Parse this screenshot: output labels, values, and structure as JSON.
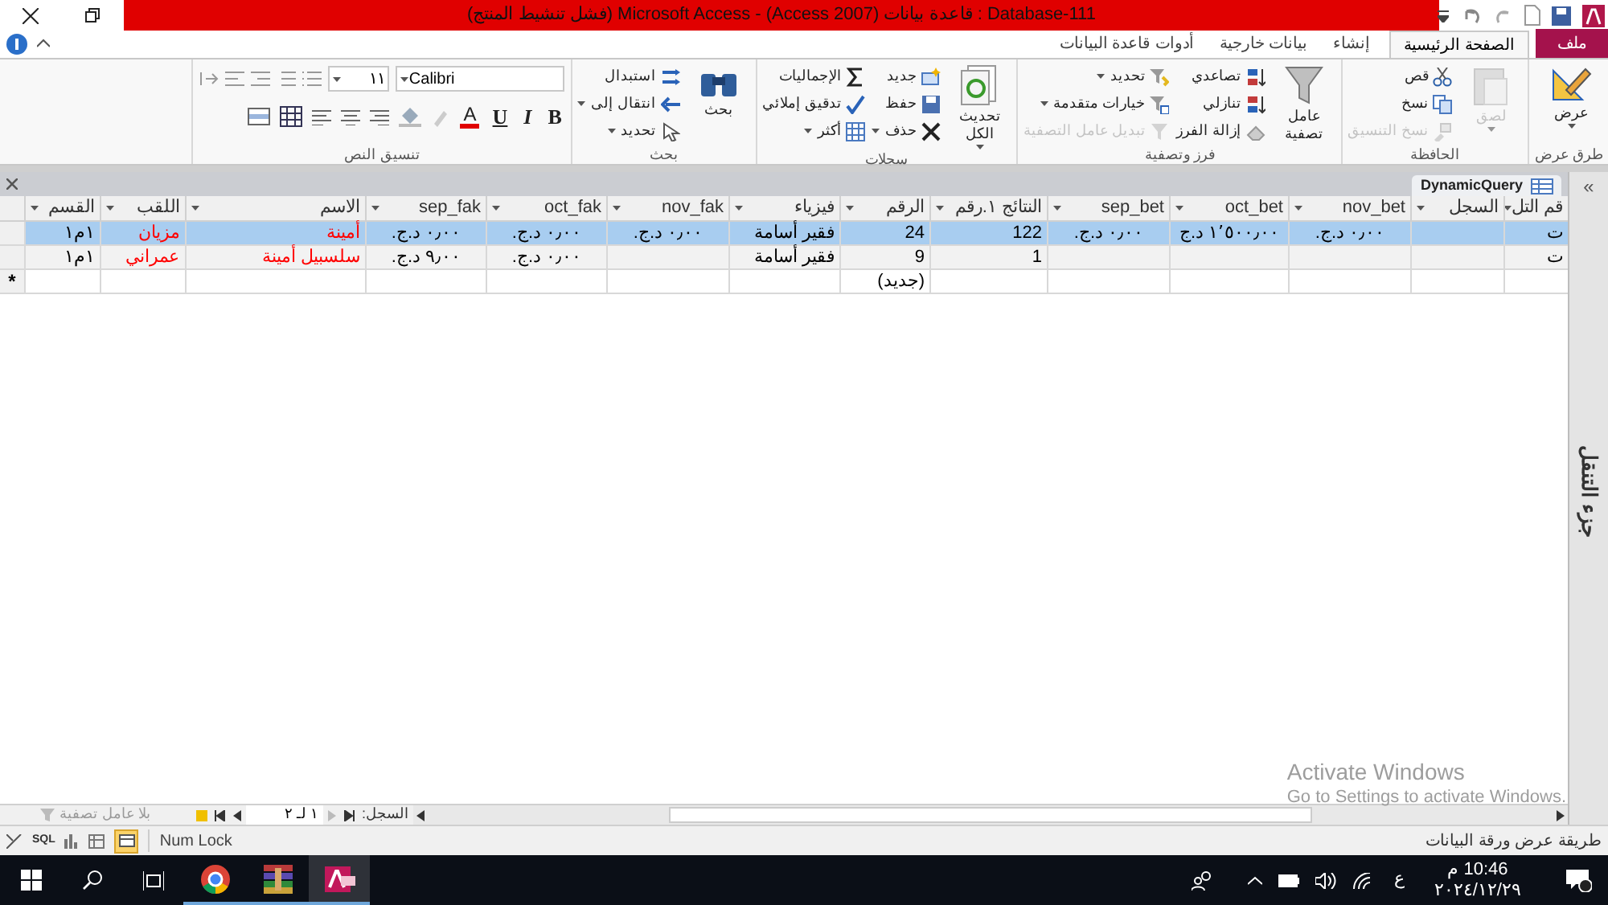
{
  "window": {
    "title": "Database-111 : قاعدة بيانات (Access 2007) - Microsoft Access (فشل تنشيط المنتج)"
  },
  "tabs": [
    {
      "label": "ملف",
      "kind": "file",
      "selected": false
    },
    {
      "label": "الصفحة الرئيسية",
      "kind": "tab",
      "selected": true
    },
    {
      "label": "إنشاء",
      "kind": "tab",
      "selected": false
    },
    {
      "label": "بيانات خارجية",
      "kind": "tab",
      "selected": false
    },
    {
      "label": "أدوات قاعدة البيانات",
      "kind": "tab",
      "selected": false
    }
  ],
  "ribbon": {
    "groups": [
      {
        "label": "طرق عرض",
        "items": [
          {
            "label": "عرض",
            "kind": "large",
            "dropdown": true,
            "disabled": false
          }
        ]
      },
      {
        "label": "الحافظة",
        "items": [
          {
            "label": "لصق",
            "kind": "large",
            "dropdown": true,
            "disabled": true
          },
          {
            "label": "قص",
            "kind": "small",
            "dropdown": false,
            "disabled": false
          },
          {
            "label": "نسخ",
            "kind": "small",
            "dropdown": false,
            "disabled": false
          },
          {
            "label": "نسخ التنسيق",
            "kind": "small",
            "dropdown": false,
            "disabled": true
          }
        ]
      },
      {
        "label": "فرز وتصفية",
        "items": [
          {
            "label": "عامل تصفية",
            "kind": "large",
            "dropdown": false,
            "disabled": false
          },
          {
            "label": "تصاعدي",
            "kind": "small",
            "dropdown": false,
            "disabled": false
          },
          {
            "label": "تنازلي",
            "kind": "small",
            "dropdown": false,
            "disabled": false
          },
          {
            "label": "إزالة الفرز",
            "kind": "small",
            "dropdown": false,
            "disabled": false
          },
          {
            "label": "تحديد",
            "kind": "small",
            "dropdown": true,
            "disabled": false
          },
          {
            "label": "خيارات متقدمة",
            "kind": "small",
            "dropdown": true,
            "disabled": false
          },
          {
            "label": "تبديل عامل التصفية",
            "kind": "small",
            "dropdown": false,
            "disabled": true
          }
        ]
      },
      {
        "label": "سجلات",
        "items": [
          {
            "label": "تحديث الكل",
            "kind": "large",
            "dropdown": true,
            "disabled": false
          },
          {
            "label": "جديد",
            "kind": "small",
            "dropdown": false,
            "disabled": false
          },
          {
            "label": "حفظ",
            "kind": "small",
            "dropdown": false,
            "disabled": false
          },
          {
            "label": "حذف",
            "kind": "small",
            "dropdown": true,
            "disabled": false
          },
          {
            "label": "الإجماليات",
            "kind": "small",
            "dropdown": false,
            "disabled": false
          },
          {
            "label": "تدقيق إملائي",
            "kind": "small",
            "dropdown": false,
            "disabled": false
          },
          {
            "label": "أكثر",
            "kind": "small",
            "dropdown": true,
            "disabled": false
          }
        ]
      },
      {
        "label": "بحث",
        "items": [
          {
            "label": "بحث",
            "kind": "large",
            "dropdown": false,
            "disabled": false
          },
          {
            "label": "استبدال",
            "kind": "small",
            "dropdown": false,
            "disabled": false
          },
          {
            "label": "انتقال إلى",
            "kind": "small",
            "dropdown": true,
            "disabled": false
          },
          {
            "label": "تحديد",
            "kind": "small",
            "dropdown": true,
            "disabled": false
          }
        ]
      }
    ],
    "text_format": {
      "label": "تنسيق النص",
      "font": "Calibri",
      "size": "١١",
      "buttons": [
        {
          "label": "B",
          "kind": "bold"
        },
        {
          "label": "I",
          "kind": "italic"
        },
        {
          "label": "U",
          "kind": "underline"
        },
        {
          "label": "A",
          "kind": "font-color"
        }
      ]
    }
  },
  "document_tab": {
    "label": "DynamicQuery"
  },
  "table": {
    "columns": [
      {
        "label": "قم التل",
        "kind": "text",
        "highlighted": false
      },
      {
        "label": "السجل",
        "kind": "text"
      },
      {
        "label": "nov_bet",
        "kind": "currency",
        "highlighted": false
      },
      {
        "label": "oct_bet",
        "kind": "currency",
        "highlighted": false
      },
      {
        "label": "sep_bet",
        "kind": "currency",
        "highlighted": false
      },
      {
        "label": "النتائج ١.رقم",
        "kind": "number",
        "highlighted": false
      },
      {
        "label": "الرقم",
        "kind": "number",
        "highlighted": false
      },
      {
        "label": "فيزياء",
        "kind": "text",
        "highlighted": false
      },
      {
        "label": "nov_fak",
        "kind": "currency",
        "highlighted": false
      },
      {
        "label": "oct_fak",
        "kind": "currency",
        "highlighted": false
      },
      {
        "label": "sep_fak",
        "kind": "currency",
        "highlighted": false
      },
      {
        "label": "الاسم",
        "kind": "text",
        "highlighted": true
      },
      {
        "label": "اللقب",
        "kind": "text",
        "highlighted": true
      },
      {
        "label": "القسم",
        "kind": "text",
        "highlighted": false
      }
    ],
    "rows": [
      {
        "selected": true,
        "cells": [
          "ت",
          null,
          "٠٫٠٠ د.ج.",
          "١٬٥٠٠٫٠٠ د.ج",
          "٠٫٠٠ د.ج.",
          "122",
          "24",
          "فقير أسامة",
          "٠٫٠٠ د.ج.",
          "٠٫٠٠ د.ج.",
          "٠٫٠٠ د.ج.",
          "أمينة",
          "مزيان",
          "١م١"
        ]
      },
      {
        "selected": false,
        "cells": [
          "ت",
          null,
          null,
          null,
          null,
          "1",
          "9",
          "فقير أسامة",
          null,
          "٠٫٠٠ د.ج.",
          "٩٫٠٠ د.ج.",
          "سلسبيل أمينة",
          "عمراني",
          "١م١"
        ]
      }
    ],
    "new_row": {
      "marker": "*",
      "cells": [
        null,
        null,
        null,
        null,
        null,
        null,
        "(جديد)",
        null,
        null,
        null,
        null,
        null,
        null,
        null
      ]
    }
  },
  "record_nav": {
    "label": "السجل:",
    "position": "١ لـ ٢",
    "filter": "بلا عامل تصفية"
  },
  "nav_pane": {
    "toggle": "«",
    "title": "جزء التنقل"
  },
  "status_bar": {
    "view": "طريقة عرض ورقة البيانات",
    "num_lock": "Num Lock",
    "sql": "SQL"
  },
  "overlay": {
    "title": "Activate Windows",
    "text": "Go to Settings to activate Windows."
  },
  "taskbar": {
    "language": "ع",
    "time": "10:46 م",
    "date": "٢٠٢٤/١٢/٢٩"
  }
}
